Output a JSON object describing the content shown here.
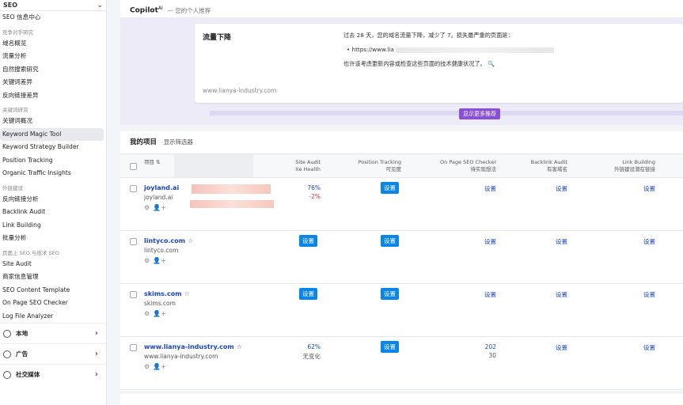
{
  "sidebar": {
    "top_label": "SEO",
    "items": [
      {
        "kind": "item",
        "label": "SEO 信息中心"
      },
      {
        "kind": "section",
        "label": "竞争对手研究"
      },
      {
        "kind": "item",
        "label": "域名概览"
      },
      {
        "kind": "item",
        "label": "流量分析"
      },
      {
        "kind": "item",
        "label": "自然搜索研究"
      },
      {
        "kind": "item",
        "label": "关键词差异"
      },
      {
        "kind": "item",
        "label": "反向链接差异"
      },
      {
        "kind": "section",
        "label": "关键词研究"
      },
      {
        "kind": "item",
        "label": "关键词概况"
      },
      {
        "kind": "item",
        "label": "Keyword Magic Tool",
        "active": true
      },
      {
        "kind": "item",
        "label": "Keyword Strategy Builder"
      },
      {
        "kind": "item",
        "label": "Position Tracking"
      },
      {
        "kind": "item",
        "label": "Organic Traffic Insights"
      },
      {
        "kind": "section",
        "label": "外链建设"
      },
      {
        "kind": "item",
        "label": "反向链接分析"
      },
      {
        "kind": "item",
        "label": "Backlink Audit"
      },
      {
        "kind": "item",
        "label": "Link Building"
      },
      {
        "kind": "item",
        "label": "批量分析"
      },
      {
        "kind": "section",
        "label": "页面上 SEO 与技术 SEO"
      },
      {
        "kind": "item",
        "label": "Site Audit"
      },
      {
        "kind": "item",
        "label": "商家信息管理"
      },
      {
        "kind": "item",
        "label": "SEO Content Template"
      },
      {
        "kind": "item",
        "label": "On Page SEO Checker"
      },
      {
        "kind": "item",
        "label": "Log File Analyzer"
      }
    ],
    "groups": [
      {
        "label": "本地",
        "icon": "location-icon"
      },
      {
        "label": "广告",
        "icon": "target-icon"
      },
      {
        "label": "社交媒体",
        "icon": "chat-icon"
      }
    ]
  },
  "copilot": {
    "name": "Copilot",
    "sup": "AI",
    "subtitle": "— 您的个人推荐",
    "card_title": "流量下降",
    "line1": "过去 28 天，您的域名流量下降，减少了 7。损失最严重的页面是：",
    "url_prefix": "https://www.lia",
    "line2": "也许该考虑更新内容或检查这些页面的技术健康状况了。",
    "domain": "www.lianya-industry.com",
    "more_button": "显示更多推荐"
  },
  "projects": {
    "title": "我的项目",
    "filter": "显示筛选器",
    "columns": {
      "project": "项目",
      "site_audit": [
        "Site Audit",
        "ite Health"
      ],
      "position_tracking": [
        "Position Tracking",
        "可见度"
      ],
      "on_page": [
        "On Page SEO Checker",
        "待实现想法"
      ],
      "backlink": [
        "Backlink Audit",
        "有害域名"
      ],
      "link_building": [
        "Link Building",
        "外链建设潜在链接"
      ]
    },
    "rows": [
      {
        "domain": "joyland.ai",
        "sub": "joyland.ai",
        "audit_value": "76%",
        "audit_delta": "-2%",
        "tracking": "设置",
        "onpage": "设置",
        "backlink": "设置",
        "linkb": "设置"
      },
      {
        "domain": "lintyco.com",
        "sub": "lintyco.com",
        "audit_button": "设置",
        "tracking": "设置",
        "onpage": "设置",
        "backlink": "设置",
        "linkb": "设置"
      },
      {
        "domain": "skims.com",
        "sub": "skims.com",
        "audit_button": "设置",
        "tracking": "设置",
        "onpage": "设置",
        "backlink": "设置",
        "linkb": "设置"
      },
      {
        "domain": "www.lianya-industry.com",
        "sub": "www.lianya-industry.com",
        "audit_value": "62%",
        "audit_delta": "无变化",
        "tracking": "设置",
        "onpage_value": "202",
        "onpage_delta": "30",
        "backlink": "设置",
        "linkb": "设置"
      }
    ]
  },
  "colors": {
    "accent": "#0a86ea",
    "link": "#1a45c4",
    "copilot_bg": "#ecebf7",
    "more_button": "#8a4fd8",
    "negative": "#e0322d"
  }
}
